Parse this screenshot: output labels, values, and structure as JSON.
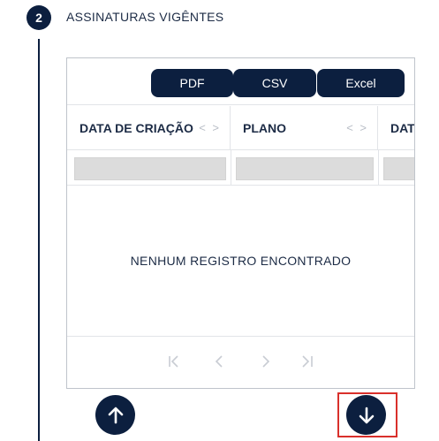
{
  "step": {
    "number": "2",
    "title": "ASSINATURAS VIGÊNTES"
  },
  "toolbar": {
    "pdf_label": "PDF",
    "csv_label": "CSV",
    "excel_label": "Excel"
  },
  "table": {
    "columns": [
      "DATA DE CRIAÇÃO",
      "PLANO",
      "DAT"
    ],
    "sort_glyph": "< >",
    "empty_message": "NENHUM REGISTRO ENCONTRADO"
  },
  "pagination": {
    "first": "|<",
    "prev": "<",
    "next": ">",
    "last": ">|"
  },
  "icons": {
    "scroll_up": "arrow-up-icon",
    "scroll_down": "arrow-down-icon"
  },
  "colors": {
    "primary": "#0c1f3f",
    "highlight": "#d9302b"
  }
}
